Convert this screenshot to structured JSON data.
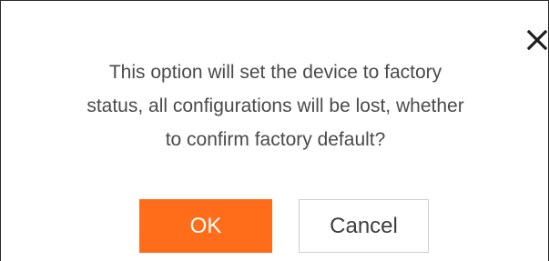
{
  "dialog": {
    "message": "This option will set the device to factory\nstatus, all configurations will be lost, whether\nto confirm factory default?",
    "close_icon": "close-icon",
    "ok_label": "OK",
    "cancel_label": "Cancel"
  },
  "colors": {
    "accent": "#ff6c1a",
    "text": "#4a4a4a",
    "border": "#cfcfcf"
  }
}
